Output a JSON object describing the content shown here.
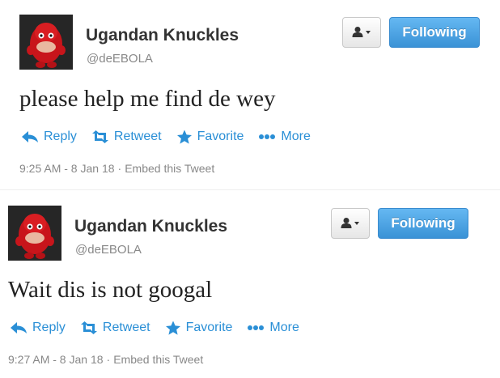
{
  "tweets": [
    {
      "display_name": "Ugandan Knuckles",
      "handle": "@deEBOLA",
      "follow_label": "Following",
      "text": "please help me find de wey",
      "actions": {
        "reply": "Reply",
        "retweet": "Retweet",
        "favorite": "Favorite",
        "more": "More"
      },
      "time": "9:25 AM - 8 Jan 18",
      "separator": "·",
      "embed": "Embed this Tweet"
    },
    {
      "display_name": "Ugandan Knuckles",
      "handle": "@deEBOLA",
      "follow_label": "Following",
      "text": "Wait dis is not googal",
      "actions": {
        "reply": "Reply",
        "retweet": "Retweet",
        "favorite": "Favorite",
        "more": "More"
      },
      "time": "9:27 AM - 8 Jan 18",
      "separator": "·",
      "embed": "Embed this Tweet"
    }
  ],
  "colors": {
    "link": "#2a8fd6",
    "follow_button": "#4aa3e6",
    "muted": "#888888"
  },
  "icons": [
    "avatar-image",
    "user-dropdown-icon",
    "reply-icon",
    "retweet-icon",
    "favorite-star-icon",
    "more-dots-icon"
  ]
}
